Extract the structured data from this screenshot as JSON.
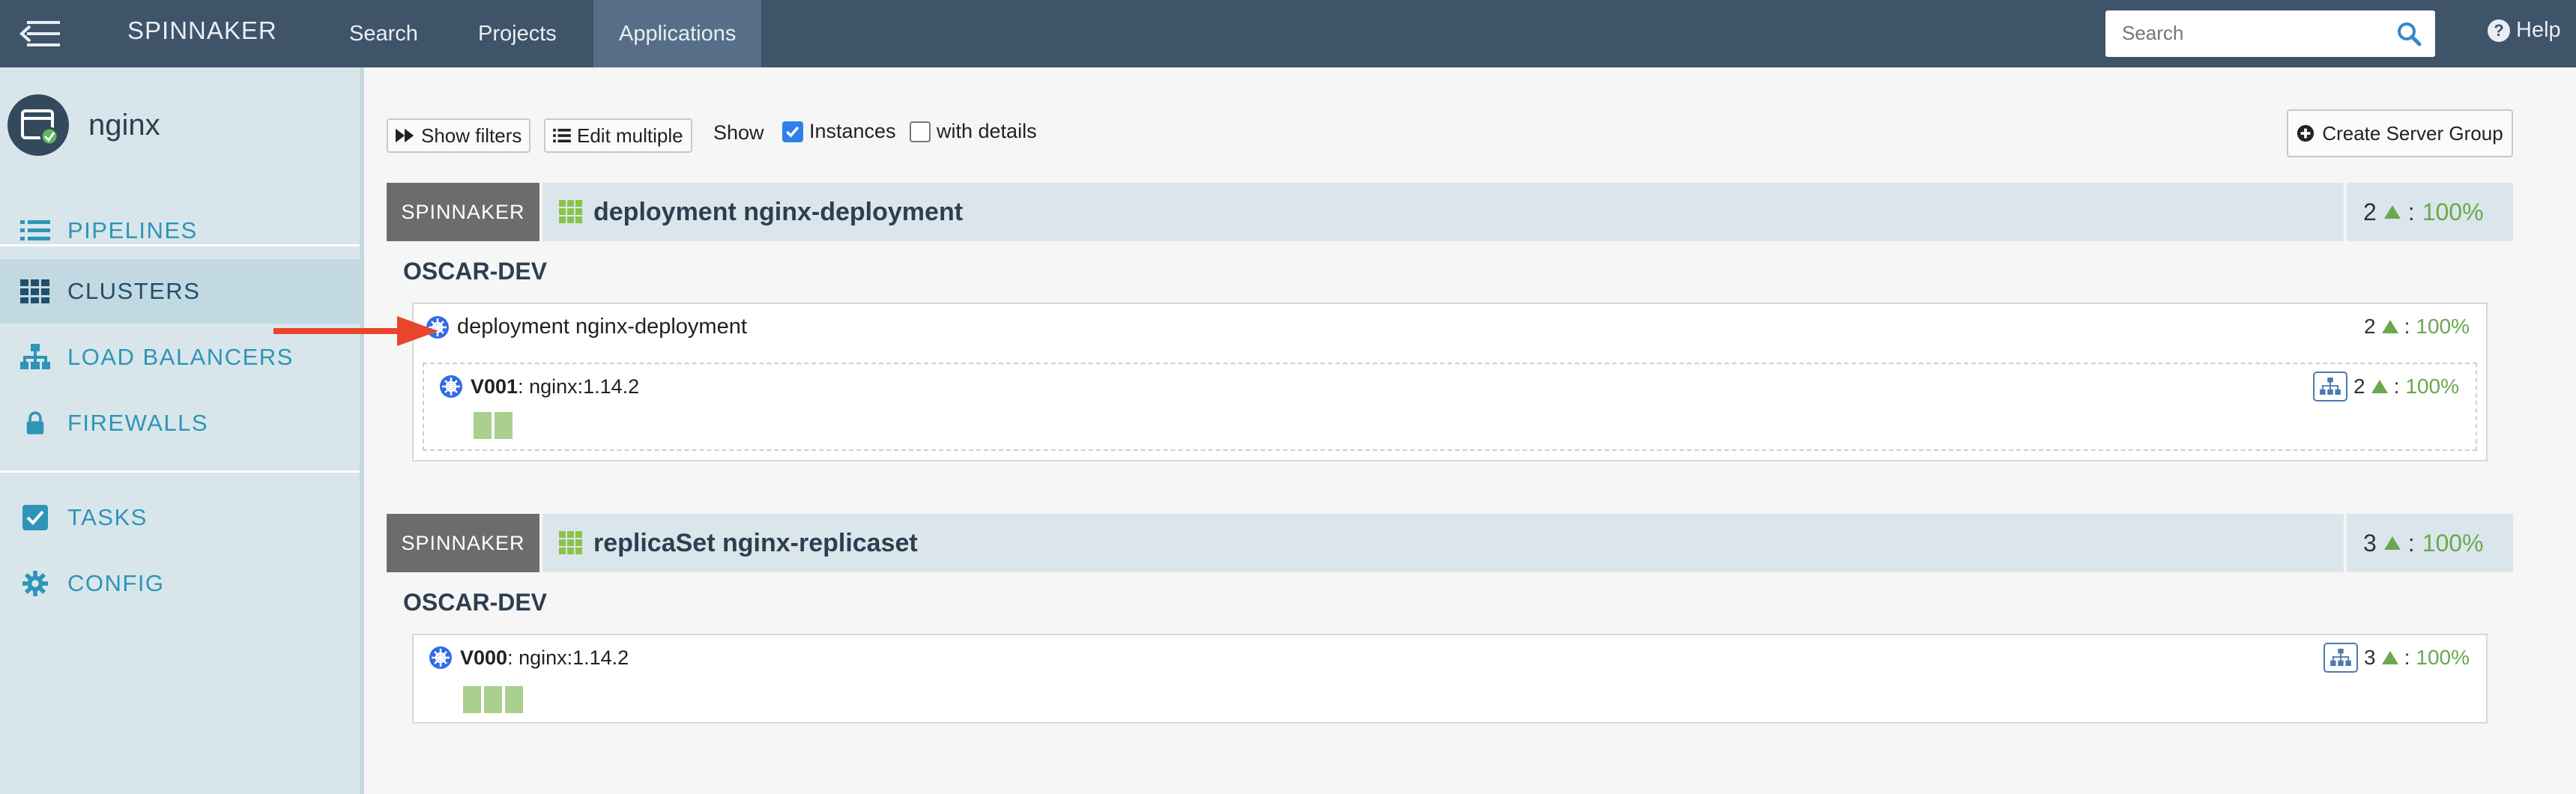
{
  "topnav": {
    "brand": "SPINNAKER",
    "links": [
      {
        "label": "Search"
      },
      {
        "label": "Projects"
      },
      {
        "label": "Applications"
      }
    ],
    "search_placeholder": "Search",
    "help_label": "Help"
  },
  "sidebar": {
    "app_name": "nginx",
    "items": [
      {
        "label": "PIPELINES",
        "icon": "list-icon"
      },
      {
        "label": "CLUSTERS",
        "icon": "grid-icon",
        "active": true
      },
      {
        "label": "LOAD BALANCERS",
        "icon": "sitemap-icon"
      },
      {
        "label": "FIREWALLS",
        "icon": "lock-icon"
      },
      {
        "label": "TASKS",
        "icon": "check-square-icon"
      },
      {
        "label": "CONFIG",
        "icon": "gear-icon"
      }
    ]
  },
  "toolbar": {
    "show_filters": "Show filters",
    "edit_multiple": "Edit multiple",
    "show": "Show",
    "instances": "Instances",
    "with_details": "with details",
    "create_server_group": "Create Server Group"
  },
  "groups": [
    {
      "account": "SPINNAKER",
      "title": "deployment nginx-deployment",
      "count": "2",
      "percent": "100%",
      "region": "OSCAR-DEV",
      "cluster": {
        "title": "deployment nginx-deployment",
        "count": "2",
        "percent": "100%",
        "server_group": {
          "name": "V001",
          "image": ": nginx:1.14.2",
          "count": "2",
          "percent": "100%",
          "instances": 2
        }
      }
    },
    {
      "account": "SPINNAKER",
      "title": "replicaSet nginx-replicaset",
      "count": "3",
      "percent": "100%",
      "region": "OSCAR-DEV",
      "cluster": {
        "server_group": {
          "name": "V000",
          "image": ": nginx:1.14.2",
          "count": "3",
          "percent": "100%",
          "instances": 3
        }
      }
    }
  ],
  "colors": {
    "nav_bg": "#3f5369",
    "sidebar_bg": "#d8e6ec",
    "accent_link": "#2e95b6",
    "healthy": "#6aa84f",
    "instance": "#a9d08e",
    "annotation_arrow": "#e8452c"
  }
}
